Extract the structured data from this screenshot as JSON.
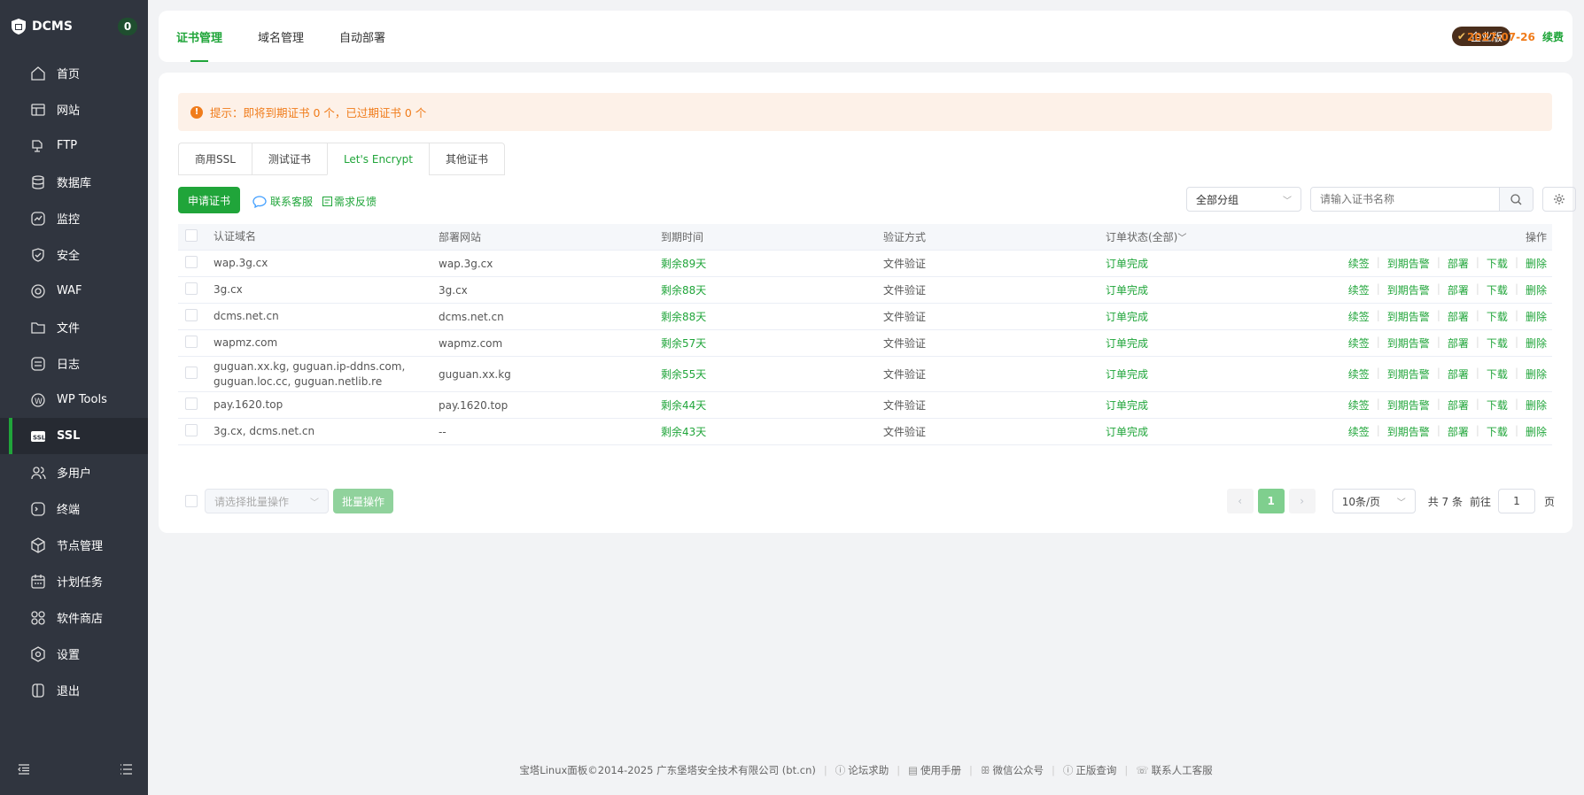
{
  "app": {
    "name": "DCMS",
    "badge": "0"
  },
  "sidebar": {
    "items": [
      {
        "label": "首页",
        "icon": "home-icon"
      },
      {
        "label": "网站",
        "icon": "website-icon"
      },
      {
        "label": "FTP",
        "icon": "ftp-icon"
      },
      {
        "label": "数据库",
        "icon": "database-icon"
      },
      {
        "label": "监控",
        "icon": "monitor-icon"
      },
      {
        "label": "安全",
        "icon": "shield-icon"
      },
      {
        "label": "WAF",
        "icon": "waf-icon"
      },
      {
        "label": "文件",
        "icon": "folder-icon"
      },
      {
        "label": "日志",
        "icon": "log-icon"
      },
      {
        "label": "WP Tools",
        "icon": "wordpress-icon"
      },
      {
        "label": "SSL",
        "icon": "ssl-icon",
        "active": true
      },
      {
        "label": "多用户",
        "icon": "users-icon"
      },
      {
        "label": "终端",
        "icon": "terminal-icon"
      },
      {
        "label": "节点管理",
        "icon": "node-icon"
      },
      {
        "label": "计划任务",
        "icon": "calendar-icon"
      },
      {
        "label": "软件商店",
        "icon": "store-icon"
      },
      {
        "label": "设置",
        "icon": "settings-icon"
      },
      {
        "label": "退出",
        "icon": "logout-icon"
      }
    ]
  },
  "topbar": {
    "tabs": [
      "证书管理",
      "域名管理",
      "自动部署"
    ],
    "edition": "企业版",
    "expire_date": "2027-07-26",
    "renew": "续费"
  },
  "notice": "提示：即将到期证书 0 个，已过期证书 0 个",
  "subtabs": [
    "商用SSL",
    "测试证书",
    "Let's Encrypt",
    "其他证书"
  ],
  "toolbar": {
    "apply": "申请证书",
    "contact": "联系客服",
    "feedback": "需求反馈",
    "group": "全部分组",
    "search_placeholder": "请输入证书名称"
  },
  "table": {
    "headers": [
      "认证域名",
      "部署网站",
      "到期时间",
      "验证方式",
      "订单状态(全部)",
      "操作"
    ],
    "rows": [
      {
        "domain": "wap.3g.cx",
        "site": "wap.3g.cx",
        "expire": "剩余89天",
        "verify": "文件验证",
        "status": "订单完成"
      },
      {
        "domain": "3g.cx",
        "site": "3g.cx",
        "expire": "剩余88天",
        "verify": "文件验证",
        "status": "订单完成"
      },
      {
        "domain": "dcms.net.cn",
        "site": "dcms.net.cn",
        "expire": "剩余88天",
        "verify": "文件验证",
        "status": "订单完成"
      },
      {
        "domain": "wapmz.com",
        "site": "wapmz.com",
        "expire": "剩余57天",
        "verify": "文件验证",
        "status": "订单完成"
      },
      {
        "domain": "guguan.xx.kg, guguan.ip-ddns.com, guguan.loc.cc, guguan.netlib.re",
        "site": "guguan.xx.kg",
        "expire": "剩余55天",
        "verify": "文件验证",
        "status": "订单完成"
      },
      {
        "domain": "pay.1620.top",
        "site": "pay.1620.top",
        "expire": "剩余44天",
        "verify": "文件验证",
        "status": "订单完成"
      },
      {
        "domain": "3g.cx, dcms.net.cn",
        "site": "--",
        "expire": "剩余43天",
        "verify": "文件验证",
        "status": "订单完成"
      }
    ],
    "actions": [
      "续签",
      "到期告警",
      "部署",
      "下载",
      "删除"
    ]
  },
  "bulk": {
    "placeholder": "请选择批量操作",
    "button": "批量操作"
  },
  "pager": {
    "current": "1",
    "size": "10条/页",
    "total": "共 7 条",
    "goto": "前往",
    "goto_value": "1",
    "unit": "页"
  },
  "footer": {
    "copyright": "宝塔Linux面板©2014-2025 广东堡塔安全技术有限公司 (bt.cn)",
    "links": [
      "论坛求助",
      "使用手册",
      "微信公众号",
      "正版查询",
      "联系人工客服"
    ]
  },
  "colors": {
    "accent": "#20a53a",
    "sidebar": "#30353f",
    "warning": "#f07c1b"
  }
}
